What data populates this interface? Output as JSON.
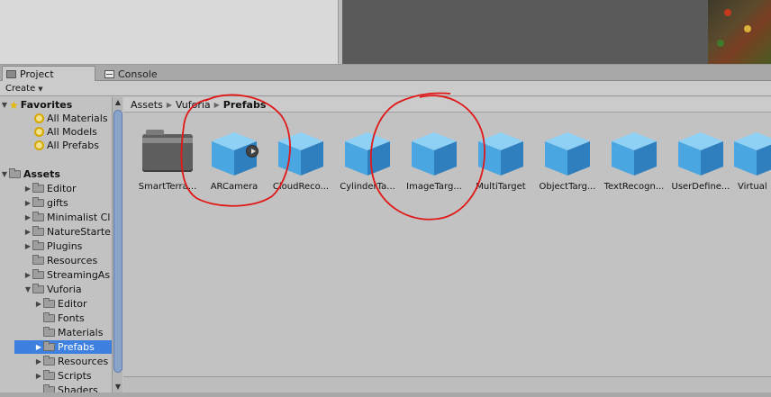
{
  "tabs": [
    {
      "label": "Project",
      "icon": "folder-icon",
      "active": true
    },
    {
      "label": "Console",
      "icon": "console-icon",
      "active": false
    }
  ],
  "toolbar": {
    "create_label": "Create"
  },
  "favorites": {
    "header": "Favorites",
    "items": [
      "All Materials",
      "All Models",
      "All Prefabs"
    ]
  },
  "assets": {
    "header": "Assets",
    "items": [
      {
        "label": "Editor",
        "level": 1,
        "expandable": true
      },
      {
        "label": "gifts",
        "level": 1,
        "expandable": true
      },
      {
        "label": "Minimalist Cl",
        "level": 1,
        "expandable": true
      },
      {
        "label": "NatureStarte",
        "level": 1,
        "expandable": true
      },
      {
        "label": "Plugins",
        "level": 1,
        "expandable": true
      },
      {
        "label": "Resources",
        "level": 1,
        "expandable": false
      },
      {
        "label": "StreamingAs",
        "level": 1,
        "expandable": true
      },
      {
        "label": "Vuforia",
        "level": 1,
        "expandable": true,
        "expanded": true
      },
      {
        "label": "Editor",
        "level": 2,
        "expandable": true
      },
      {
        "label": "Fonts",
        "level": 2,
        "expandable": false
      },
      {
        "label": "Materials",
        "level": 2,
        "expandable": false
      },
      {
        "label": "Prefabs",
        "level": 2,
        "expandable": true,
        "selected": true
      },
      {
        "label": "Resources",
        "level": 2,
        "expandable": true
      },
      {
        "label": "Scripts",
        "level": 2,
        "expandable": true
      },
      {
        "label": "Shaders",
        "level": 2,
        "expandable": false
      }
    ]
  },
  "breadcrumb": {
    "parts": [
      "Assets",
      "Vuforia"
    ],
    "current": "Prefabs"
  },
  "grid_items": [
    {
      "label": "SmartTerra...",
      "kind": "folder"
    },
    {
      "label": "ARCamera",
      "kind": "prefab",
      "play": true
    },
    {
      "label": "CloudReco...",
      "kind": "prefab"
    },
    {
      "label": "CylinderTa...",
      "kind": "prefab"
    },
    {
      "label": "ImageTarg...",
      "kind": "prefab"
    },
    {
      "label": "MultiTarget",
      "kind": "prefab"
    },
    {
      "label": "ObjectTarg...",
      "kind": "prefab"
    },
    {
      "label": "TextRecogn...",
      "kind": "prefab"
    },
    {
      "label": "UserDefine...",
      "kind": "prefab"
    },
    {
      "label": "Virtual",
      "kind": "prefab"
    }
  ],
  "colors": {
    "selection": "#3d80df",
    "cube_light": "#8fd0f5",
    "cube_mid": "#4aa6e0",
    "cube_dark": "#2f7fbf",
    "annotation": "#e01818"
  }
}
